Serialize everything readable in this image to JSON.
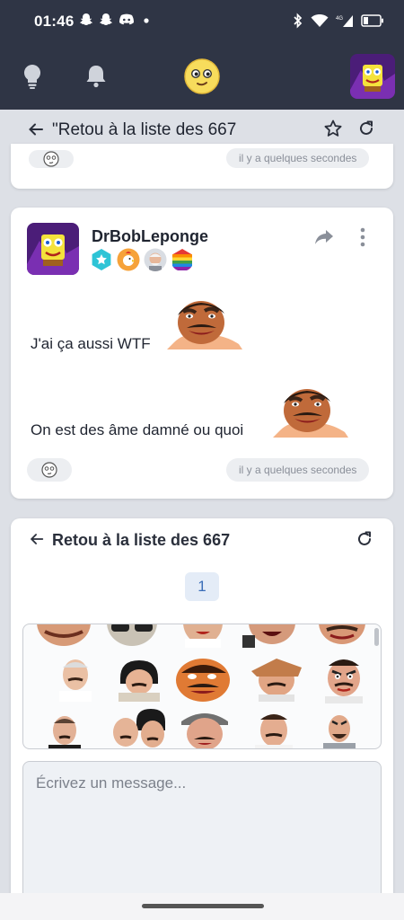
{
  "status": {
    "time": "01:46",
    "notification_icons": [
      "snapchat-icon",
      "snapchat-icon",
      "discord-icon",
      "dot-icon"
    ],
    "right_icons": [
      "bluetooth-icon",
      "wifi-icon",
      "4g-signal-icon",
      "battery-icon"
    ]
  },
  "topbar": {
    "icons": [
      "bulb-icon",
      "bell-icon",
      "site-logo",
      "user-avatar"
    ]
  },
  "sticky_header": {
    "title": "\"Retou à la liste des 667",
    "icons": [
      "back-arrow-icon",
      "star-icon",
      "refresh-icon"
    ]
  },
  "prev_post": {
    "reaction_icon": "smiley-icon",
    "time": "il y a quelques secondes"
  },
  "post": {
    "username": "DrBobLeponge",
    "badges": [
      "star-badge",
      "chicken-badge",
      "old-man-badge",
      "rainbow-badge"
    ],
    "lines": [
      {
        "text": "J'ai ça aussi WTF"
      },
      {
        "text": "On est des âme damné ou quoi"
      }
    ],
    "reaction_icon": "smiley-icon",
    "time": "il y a quelques secondes"
  },
  "reply_panel": {
    "title": "Retou à la liste des 667",
    "page": "1",
    "message_placeholder": "Écrivez un message..."
  },
  "colors": {
    "topbar": "#2f3545",
    "background": "#dde0e6",
    "pager_text": "#3a6db8"
  }
}
